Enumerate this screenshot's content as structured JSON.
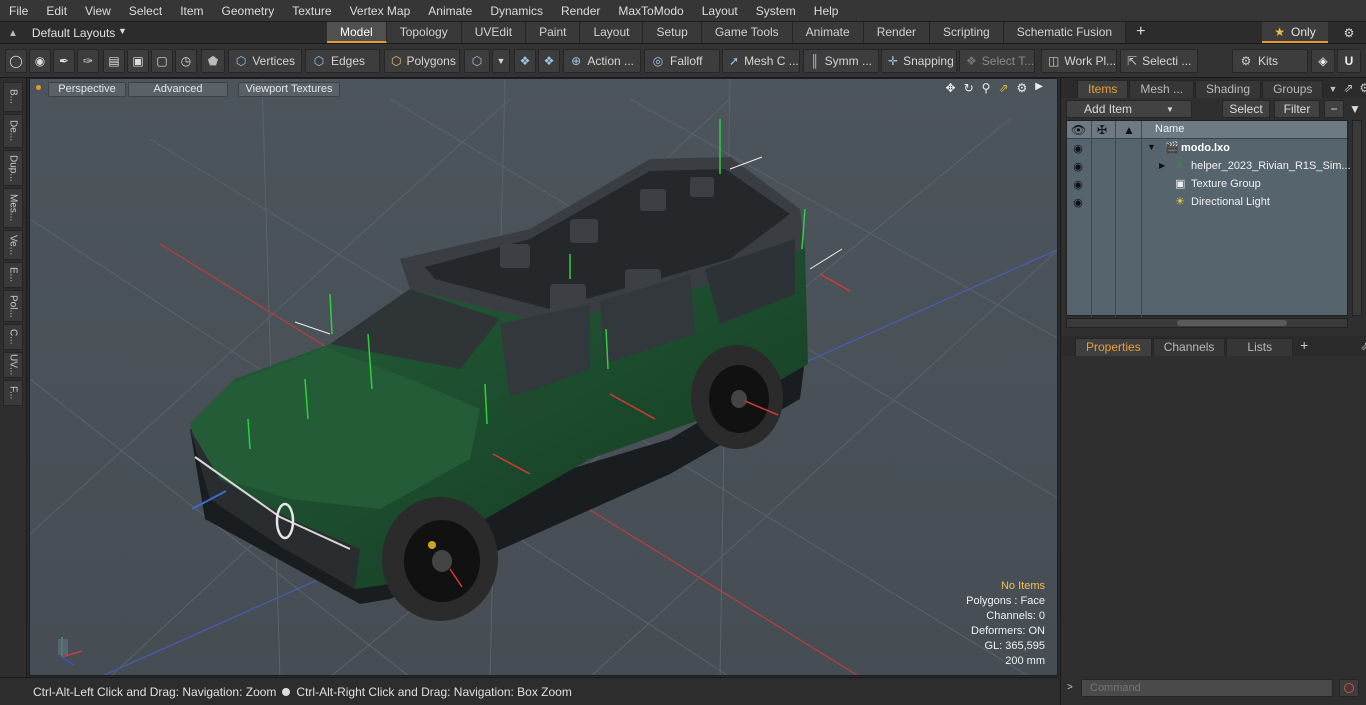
{
  "menubar": {
    "items": [
      "File",
      "Edit",
      "View",
      "Select",
      "Item",
      "Geometry",
      "Texture",
      "Vertex Map",
      "Animate",
      "Dynamics",
      "Render",
      "MaxToModo",
      "Layout",
      "System",
      "Help"
    ]
  },
  "layouts": {
    "label": "Default Layouts"
  },
  "tabs": [
    "Model",
    "Topology",
    "UVEdit",
    "Paint",
    "Layout",
    "Setup",
    "Game Tools",
    "Animate",
    "Render",
    "Scripting",
    "Schematic Fusion"
  ],
  "active_tab": "Model",
  "only": {
    "label": "Only"
  },
  "toolbar": {
    "vertices": "Vertices",
    "edges": "Edges",
    "polygons": "Polygons",
    "action": "Action ...",
    "falloff": "Falloff",
    "mesh": "Mesh C ...",
    "symm": "Symm ...",
    "snapping": "Snapping",
    "select_t": "Select T...",
    "work_pl": "Work Pl...",
    "selecti": "Selecti ...",
    "kits": "Kits"
  },
  "left_tabs": [
    "B...",
    "De...",
    "Dup...",
    "Mes...",
    "Ve...",
    "E...",
    "Pol...",
    "C...",
    "UV...",
    "F..."
  ],
  "viewport": {
    "perspective": "Perspective",
    "advanced": "Advanced",
    "viewport_textures": "Viewport Textures",
    "info": {
      "no_items": "No Items",
      "polygons": "Polygons : Face",
      "channels": "Channels: 0",
      "deformers": "Deformers: ON",
      "gl": "GL: 365,595",
      "scale": "200 mm"
    }
  },
  "status": {
    "hint_left": "Ctrl-Alt-Left Click and Drag: Navigation: Zoom",
    "hint_right": "Ctrl-Alt-Right Click and Drag: Navigation: Box Zoom"
  },
  "items_panel": {
    "tabs": [
      "Items",
      "Mesh ...",
      "Shading",
      "Groups"
    ],
    "active": "Items",
    "add_item": "Add Item",
    "select": "Select",
    "filter": "Filter",
    "col_name": "Name",
    "rows": [
      "modo.lxo",
      "helper_2023_Rivian_R1S_Sim...",
      "Texture Group",
      "Directional Light"
    ]
  },
  "props_panel": {
    "tabs": [
      "Properties",
      "Channels",
      "Lists"
    ],
    "active": "Properties"
  },
  "command": {
    "placeholder": "Command"
  },
  "colors": {
    "accent": "#e39a2e",
    "viewport_bg": "#4b535a",
    "car_green": "#1d4a2c"
  }
}
